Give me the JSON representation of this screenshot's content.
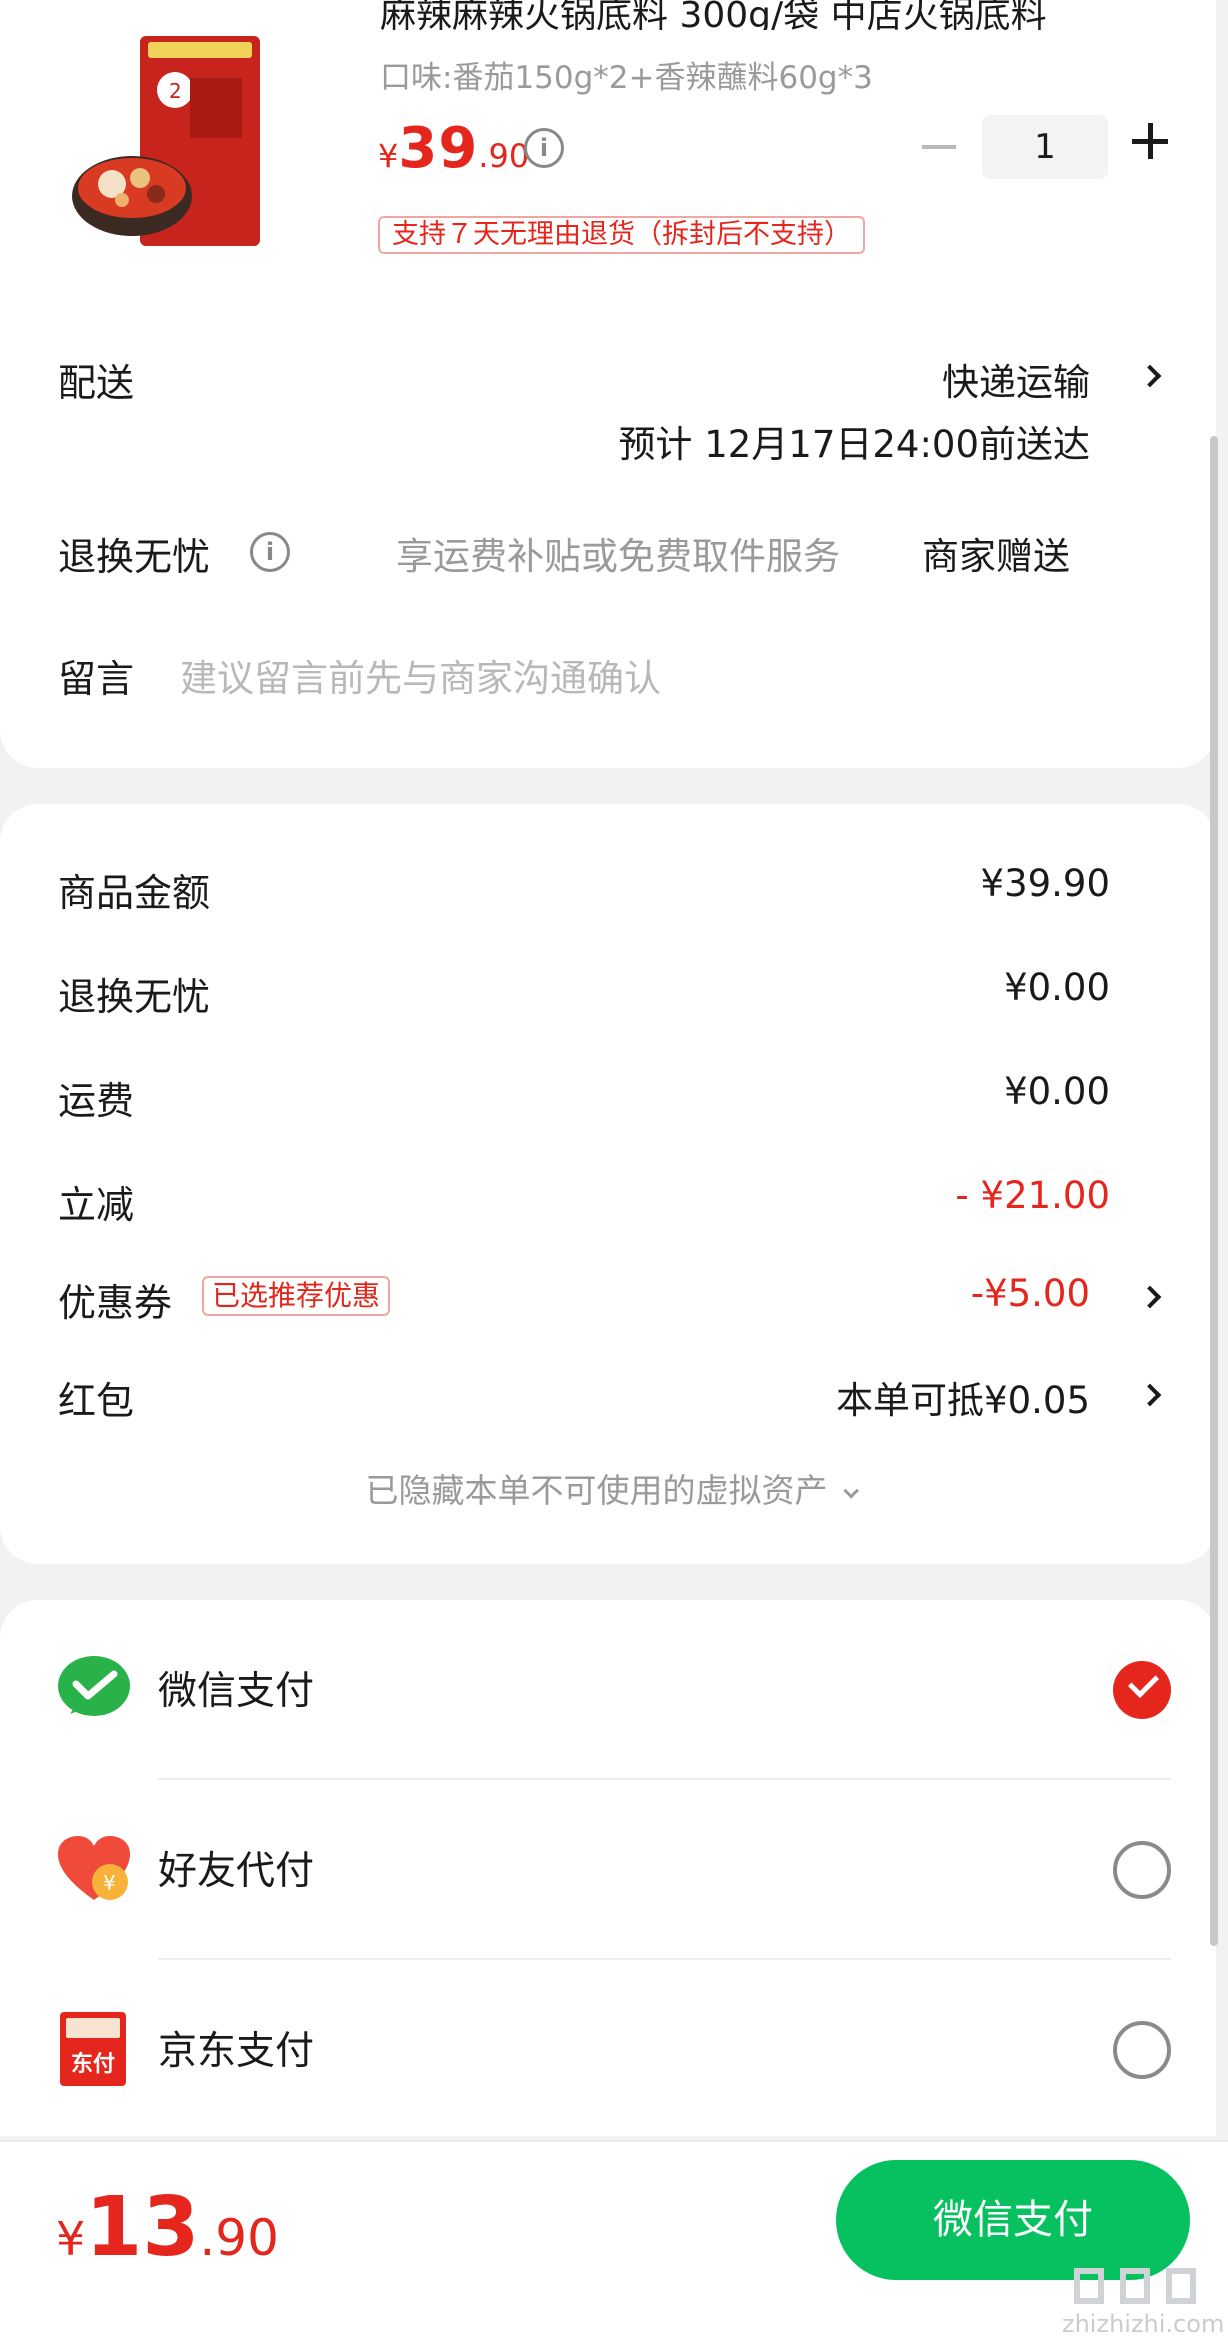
{
  "product": {
    "title": "麻辣麻辣火锅底料 300g/袋 中店火锅底料",
    "spec": "口味:番茄150g*2+香辣蘸料60g*3",
    "price_symbol": "¥",
    "price_int": "39",
    "price_dec": ".90",
    "quantity": "1",
    "return_badge": "支持７天无理由退货（拆封后不支持）",
    "image_icon": "product-thumbnail"
  },
  "delivery": {
    "label": "配送",
    "method": "快递运输",
    "eta": "预计 12月17日24:00前送达"
  },
  "worry_free": {
    "label": "退换无忧",
    "desc": "享运费补贴或免费取件服务",
    "value": "商家赠送"
  },
  "message": {
    "label": "留言",
    "placeholder": "建议留言前先与商家沟通确认"
  },
  "amounts": [
    {
      "label": "商品金额",
      "value": "¥39.90",
      "red": false
    },
    {
      "label": "退换无忧",
      "value": "¥0.00",
      "red": false
    },
    {
      "label": "运费",
      "value": "¥0.00",
      "red": false
    },
    {
      "label": "立减",
      "value": "- ¥21.00",
      "red": true
    },
    {
      "label": "优惠券",
      "value": "-¥5.00",
      "red": true,
      "tag": "已选推荐优惠"
    },
    {
      "label": "红包",
      "value": "本单可抵¥0.05",
      "red": false
    }
  ],
  "hidden_assets": "已隐藏本单不可使用的虚拟资产",
  "payment_methods": [
    {
      "label": "微信支付",
      "icon": "wechat-pay-icon",
      "selected": true
    },
    {
      "label": "好友代付",
      "icon": "friend-pay-icon",
      "selected": false
    },
    {
      "label": "京东支付",
      "icon": "jd-pay-icon",
      "icon_text": "东付",
      "selected": false
    }
  ],
  "bottom": {
    "total_symbol": "¥",
    "total_int": "13",
    "total_dec": ".90",
    "pay_button": "微信支付",
    "watermark": "zhizhizhi.com"
  },
  "colors": {
    "accent_red": "#e4261c",
    "wechat_green": "#07c160"
  }
}
